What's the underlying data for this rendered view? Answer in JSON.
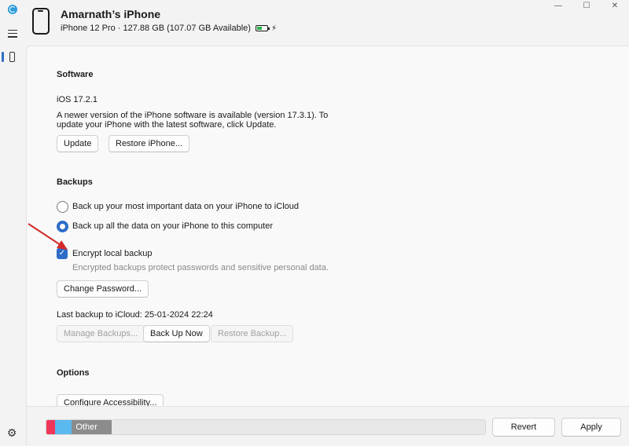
{
  "window": {
    "minimize": "—",
    "maximize": "☐",
    "close": "✕"
  },
  "header": {
    "device_name": "Amarnath’s iPhone",
    "device_info": "iPhone 12 Pro · 127.88 GB (107.07 GB Available)",
    "battery_level": 0.4,
    "charging": true
  },
  "software": {
    "title": "Software",
    "version": "iOS 17.2.1",
    "update_line1": "A newer version of the iPhone software is available (version 17.3.1). To",
    "update_line2": "update your iPhone with the latest software, click Update.",
    "update_button": "Update",
    "restore_button": "Restore iPhone..."
  },
  "backups": {
    "title": "Backups",
    "option_icloud": "Back up your most important data on your iPhone to iCloud",
    "option_computer": "Back up all the data on your iPhone to this computer",
    "selected_option": "computer",
    "encrypt_label": "Encrypt local backup",
    "encrypt_checked": true,
    "encrypt_help": "Encrypted backups protect passwords and sensitive personal data.",
    "change_password_button": "Change Password...",
    "last_backup": "Last backup to iCloud: 25-01-2024 22:24",
    "manage_button": "Manage Backups...",
    "backup_now_button": "Back Up Now",
    "restore_backup_button": "Restore Backup..."
  },
  "options": {
    "title": "Options",
    "configure_button": "Configure Accessibility..."
  },
  "footer": {
    "storage_segments": [
      {
        "label": "",
        "color": "#f0365a",
        "fraction": 0.019
      },
      {
        "label": "",
        "color": "#5ab9ef",
        "fraction": 0.039
      },
      {
        "label": "Other",
        "color": "#8c8c8c",
        "fraction": 0.09
      }
    ],
    "revert_button": "Revert",
    "apply_button": "Apply"
  },
  "colors": {
    "accent": "#2d6cc8",
    "annotation_arrow": "#d42a2a"
  }
}
